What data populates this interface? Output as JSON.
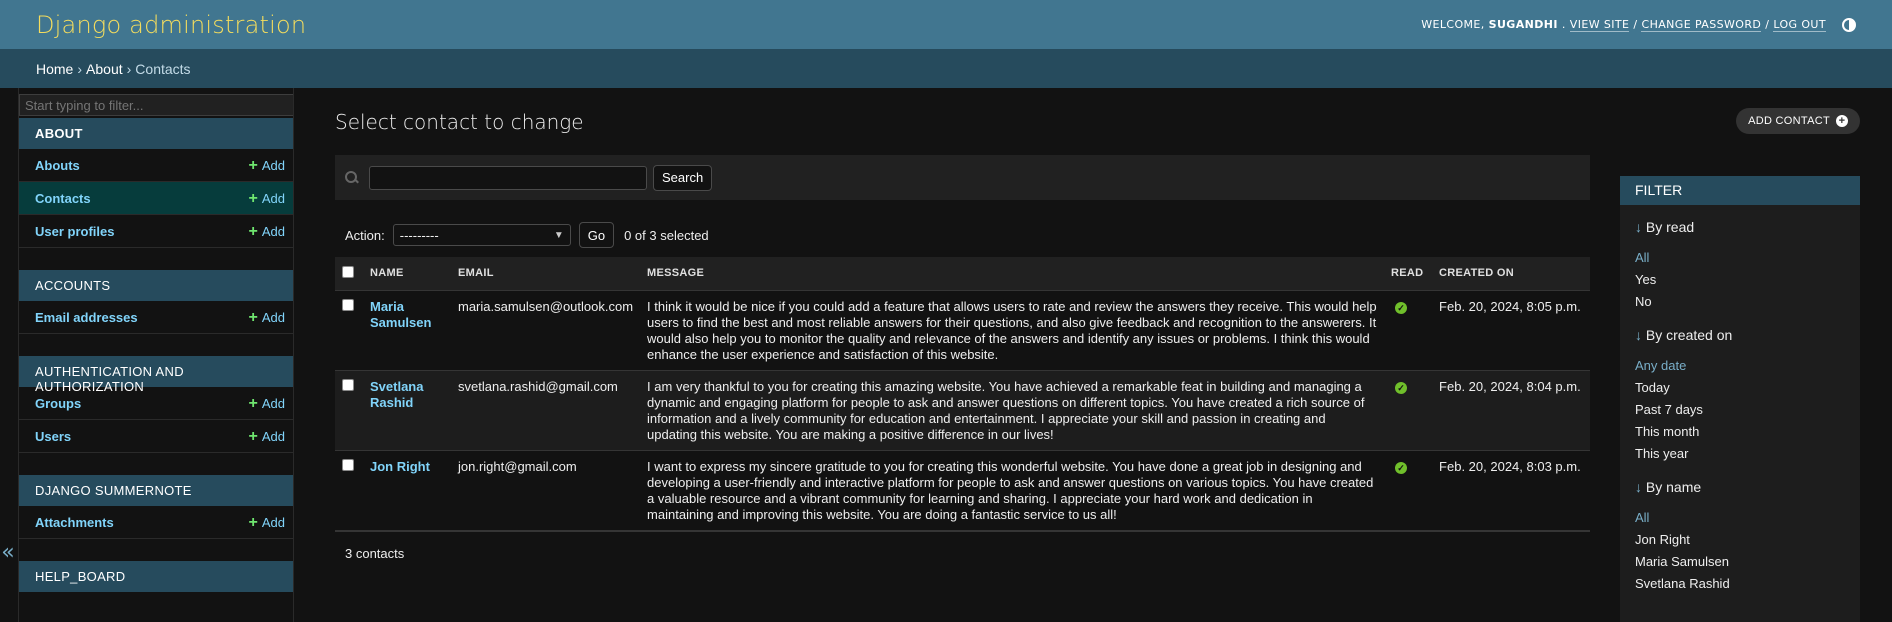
{
  "header": {
    "branding": "Django administration",
    "welcome": "Welcome,",
    "username": "SUGANDHI",
    "view_site": "View site",
    "change_password": "Change password",
    "log_out": "Log out",
    "sep1": ".",
    "sep2": "/",
    "sep3": "/"
  },
  "breadcrumbs": {
    "home": "Home",
    "about": "About",
    "current": "Contacts",
    "sep": "›"
  },
  "sidebar": {
    "filter_placeholder": "Start typing to filter...",
    "add_label": "Add",
    "modules": [
      {
        "caption": "About",
        "items": [
          {
            "label": "Abouts"
          },
          {
            "label": "Contacts"
          },
          {
            "label": "User profiles"
          }
        ]
      },
      {
        "caption": "Accounts",
        "items": [
          {
            "label": "Email addresses"
          }
        ]
      },
      {
        "caption": "Authentication and Authorization",
        "items": [
          {
            "label": "Groups"
          },
          {
            "label": "Users"
          }
        ]
      },
      {
        "caption": "Django Summernote",
        "items": [
          {
            "label": "Attachments"
          }
        ]
      },
      {
        "caption": "Help_board",
        "items": []
      }
    ]
  },
  "content": {
    "title": "Select contact to change",
    "add_button": "Add contact",
    "search_button": "Search",
    "action_label": "Action:",
    "action_value": "---------",
    "go_button": "Go",
    "selected_counter": "0 of 3 selected",
    "columns": [
      "Name",
      "Email",
      "Message",
      "Read",
      "Created on"
    ],
    "rows": [
      {
        "name": "Maria Samulsen",
        "email": "maria.samulsen@outlook.com",
        "message": "I think it would be nice if you could add a feature that allows users to rate and review the answers they receive. This would help users to find the best and most reliable answers for their questions, and also give feedback and recognition to the answerers. It would also help you to monitor the quality and relevance of the answers and identify any issues or problems. I think this would enhance the user experience and satisfaction of this website.",
        "read": true,
        "created_on": "Feb. 20, 2024, 8:05 p.m."
      },
      {
        "name": "Svetlana Rashid",
        "email": "svetlana.rashid@gmail.com",
        "message": "I am very thankful to you for creating this amazing website. You have achieved a remarkable feat in building and managing a dynamic and engaging platform for people to ask and answer questions on different topics. You have created a rich source of information and a lively community for education and entertainment. I appreciate your skill and passion in creating and updating this website. You are making a positive difference in our lives!",
        "read": true,
        "created_on": "Feb. 20, 2024, 8:04 p.m."
      },
      {
        "name": "Jon Right",
        "email": "jon.right@gmail.com",
        "message": "I want to express my sincere gratitude to you for creating this wonderful website. You have done a great job in designing and developing a user-friendly and interactive platform for people to ask and answer questions on various topics. You have created a valuable resource and a vibrant community for learning and sharing. I appreciate your hard work and dedication in maintaining and improving this website. You are doing a fantastic service to us all!",
        "read": true,
        "created_on": "Feb. 20, 2024, 8:03 p.m."
      }
    ],
    "paginator": "3 contacts"
  },
  "filter": {
    "title": "Filter",
    "groups": [
      {
        "title": "By read",
        "options": [
          "All",
          "Yes",
          "No"
        ]
      },
      {
        "title": "By created on",
        "options": [
          "Any date",
          "Today",
          "Past 7 days",
          "This month",
          "This year"
        ]
      },
      {
        "title": "By name",
        "options": [
          "All",
          "Jon Right",
          "Maria Samulsen",
          "Svetlana Rashid"
        ]
      }
    ]
  },
  "colors": {
    "header_bg": "#417690",
    "breadcrumb_bg": "#264b5d",
    "branding": "#f5dd5d",
    "link": "#81d4fa",
    "add_plus": "#6fe66f",
    "read_icon": "#70bf2b"
  }
}
